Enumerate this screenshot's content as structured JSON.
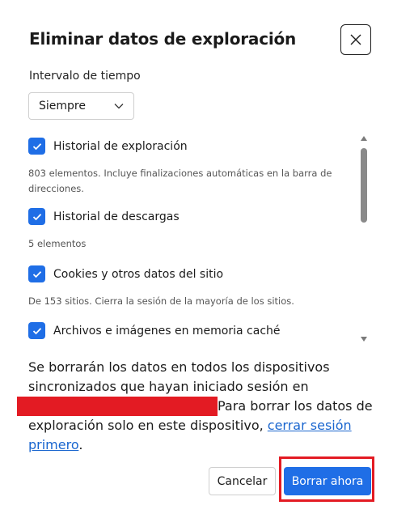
{
  "dialog": {
    "title": "Eliminar datos de exploración",
    "close_icon": "close-icon"
  },
  "time_range": {
    "label": "Intervalo de tiempo",
    "selected": "Siempre",
    "dropdown_icon": "chevron-down-icon"
  },
  "items": [
    {
      "label": "Historial de exploración",
      "description": "803 elementos. Incluye finalizaciones automáticas en la barra de direcciones.",
      "checked": true
    },
    {
      "label": "Historial de descargas",
      "description": "5 elementos",
      "checked": true
    },
    {
      "label": "Cookies y otros datos del sitio",
      "description": "De 153 sitios. Cierra la sesión de la mayoría de los sitios.",
      "checked": true
    },
    {
      "label": "Archivos e imágenes en memoria caché",
      "description": "",
      "checked": true
    }
  ],
  "sync_note": {
    "part1": "Se borrarán los datos en todos los dispositivos sincronizados que hayan iniciado sesión en",
    "part2": "Para borrar los datos de exploración solo en este dispositivo,",
    "link": "cerrar sesión primero",
    "end": "."
  },
  "buttons": {
    "cancel": "Cancelar",
    "clear": "Borrar ahora"
  },
  "colors": {
    "accent": "#1f6ee6",
    "link": "#1a66cf",
    "redaction": "#e31b23"
  }
}
